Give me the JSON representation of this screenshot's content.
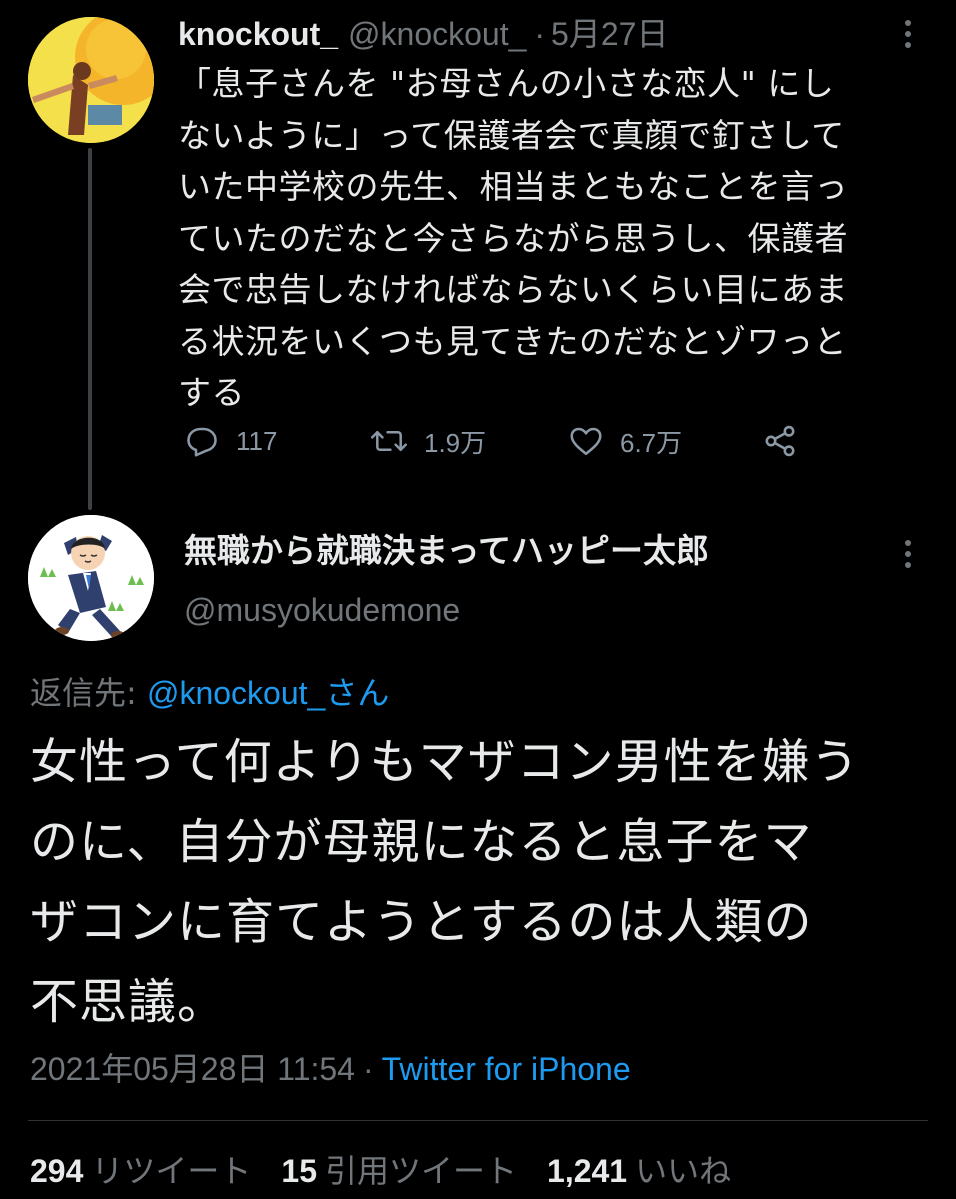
{
  "parent_tweet": {
    "display_name": "knockout_",
    "handle": "@knockout_",
    "dot": "·",
    "date": "5月27日",
    "text_lines": [
      "「息子さんを \"お母さんの小さな恋人\" にし",
      "ないように」って保護者会で真顔で釘さして",
      "いた中学校の先生、相当まともなことを言っ",
      "ていたのだなと今さらながら思うし、保護者",
      "会で忠告しなければならないくらい目にあま",
      "る状況をいくつも見てきたのだなとゾワっと",
      "する"
    ],
    "reply_count": "117",
    "retweet_count": "1.9万",
    "like_count": "6.7万",
    "icons": {
      "reply": "reply-icon",
      "retweet": "retweet-icon",
      "like": "heart-icon",
      "share": "share-icon",
      "more": "more-icon"
    }
  },
  "focus_tweet": {
    "display_name": "無職から就職決まってハッピー太郎",
    "handle": "@musyokudemone",
    "reply_to_label": "返信先:",
    "reply_to_user": "@knockout_さん",
    "text_lines": [
      "女性って何よりもマザコン男性を嫌う",
      "のに、自分が母親になると息子をマ",
      "ザコンに育てようとするのは人類の",
      "不思議。"
    ],
    "timestamp": "2021年05月28日 11:54",
    "separator": "·",
    "source": "Twitter for iPhone",
    "stats": {
      "retweets_num": "294",
      "retweets_label": "リツイート",
      "quotes_num": "15",
      "quotes_label": "引用ツイート",
      "likes_num": "1,241",
      "likes_label": "いいね"
    }
  },
  "colors": {
    "background": "#000000",
    "text_primary": "#e7e9ea",
    "text_secondary": "#71767b",
    "link": "#1d9bf0",
    "divider": "#2f3336",
    "avatar1_bg": "#f5e23a",
    "avatar2_bg": "#ffffff"
  }
}
